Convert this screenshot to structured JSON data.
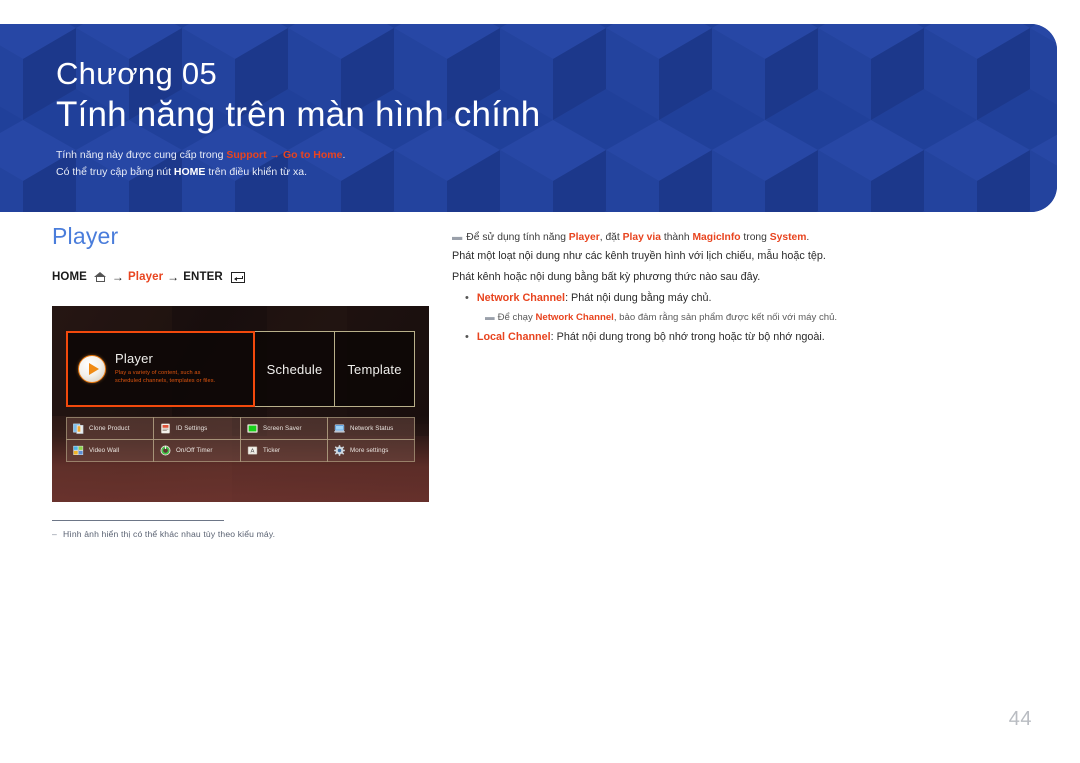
{
  "banner": {
    "chapter_label": "Chương 05",
    "chapter_title": "Tính năng trên màn hình chính",
    "note1_pre": "Tính năng này được cung cấp trong ",
    "note1_link1": "Support",
    "note1_arrow": " → ",
    "note1_link2": "Go to Home",
    "note1_post": ".",
    "note2_pre": "Có thể truy cập bằng nút ",
    "note2_bold": "HOME",
    "note2_post": " trên điều khiển từ xa.",
    "accent_color": "#21409a",
    "link_color": "#e8441f"
  },
  "left": {
    "section_title": "Player",
    "nav": {
      "home": "HOME",
      "home_icon": "home-icon",
      "arrow1": "→",
      "player": "Player",
      "arrow2": "→",
      "enter": "ENTER",
      "enter_icon": "enter-key-icon"
    },
    "screenshot": {
      "tiles": [
        {
          "name": "Player",
          "label": "Player",
          "description_line1": "Play a variety of content, such as",
          "description_line2": "scheduled channels, templates or files.",
          "icon": "play-circle-icon",
          "selected": true,
          "border_color": "#f2490c"
        },
        {
          "name": "Schedule",
          "label": "Schedule",
          "selected": false,
          "border_color": "#b9b08a"
        },
        {
          "name": "Template",
          "label": "Template",
          "selected": false,
          "border_color": "#b9b08a"
        }
      ],
      "grid": [
        [
          {
            "label": "Clone Product",
            "icon": "clone-product-icon"
          },
          {
            "label": "ID Settings",
            "icon": "id-settings-icon"
          },
          {
            "label": "Screen Saver",
            "icon": "screen-saver-icon"
          },
          {
            "label": "Network Status",
            "icon": "network-status-icon"
          }
        ],
        [
          {
            "label": "Video Wall",
            "icon": "video-wall-icon"
          },
          {
            "label": "On/Off Timer",
            "icon": "on-off-timer-icon"
          },
          {
            "label": "Ticker",
            "icon": "ticker-icon"
          },
          {
            "label": "More settings",
            "icon": "more-settings-icon"
          }
        ]
      ]
    },
    "caption_dash": "‒",
    "caption": "Hình ảnh hiển thị có thể khác nhau tùy theo kiểu máy."
  },
  "right": {
    "note": {
      "dash": "▬",
      "p1": "Để sử dụng tính năng ",
      "b1": "Player",
      "p2": ", đặt ",
      "b2": "Play via",
      "p3": " thành ",
      "b3": "MagicInfo",
      "p4": " trong ",
      "b4": "System",
      "p5": "."
    },
    "paragraph1": "Phát một loạt nội dung như các kênh truyền hình với lịch chiếu, mẫu hoặc tệp.",
    "paragraph2": "Phát kênh hoặc nội dung bằng bất kỳ phương thức nào sau đây.",
    "bullet1": {
      "dot": "•",
      "term": "Network Channel",
      "text": ": Phát nội dung bằng máy chủ."
    },
    "subnote1": {
      "dash": "▬",
      "p1": "Để chạy ",
      "b1": "Network Channel",
      "p2": ", bảo đảm rằng sản phẩm được kết nối với máy chủ."
    },
    "bullet2": {
      "dot": "•",
      "term": "Local Channel",
      "text": ": Phát nội dung trong bộ nhớ trong hoặc từ bộ nhớ ngoài."
    }
  },
  "page_number": "44"
}
